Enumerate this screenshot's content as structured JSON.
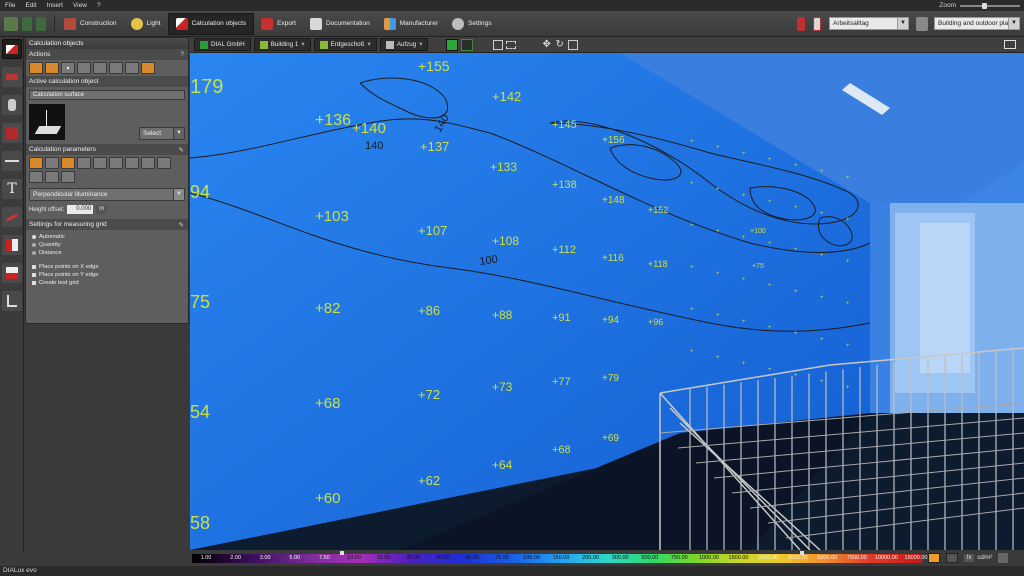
{
  "menu": [
    "File",
    "Edit",
    "Insert",
    "View",
    "?"
  ],
  "zoom_label": "Zoom",
  "toolbar": {
    "tabs": [
      {
        "label": "Construction",
        "icon": "construction-icon",
        "active": false
      },
      {
        "label": "Light",
        "icon": "light-icon",
        "active": false
      },
      {
        "label": "Calculation objects",
        "icon": "calculation-objects-icon",
        "active": true
      },
      {
        "label": "Export",
        "icon": "export-icon",
        "active": false
      },
      {
        "label": "Documentation",
        "icon": "documentation-icon",
        "active": false
      },
      {
        "label": "Manufacturer",
        "icon": "manufacturer-icon",
        "active": false
      },
      {
        "label": "Settings",
        "icon": "settings-icon",
        "active": false
      }
    ],
    "scene_select": "Arbeitsalltag",
    "view_select": "Building and outdoor pla..."
  },
  "panel": {
    "title": "Calculation objects",
    "actions_title": "Actions",
    "help": "?",
    "active_title": "Active calculation object",
    "surface_field": "Calculation surface",
    "select_button": "Select",
    "params_title": "Calculation parameters",
    "param_select": "Perpendicular illuminance",
    "height_label": "Height offset:",
    "height_value": "0.000",
    "height_unit": "m",
    "grid_title": "Settings for measuring grid",
    "grid_modes": [
      "Automatic",
      "Quantity",
      "Distance"
    ],
    "grid_options": [
      "Place points on X edge",
      "Place points on Y edge",
      "Create test grid"
    ]
  },
  "viewbar": {
    "tags": [
      "DIAL GmbH",
      "Building 1",
      "Erdgeschoß",
      "Aufzug"
    ]
  },
  "scene": {
    "wall_color": "#1f6fe0",
    "iso_color": "#1c1c1c",
    "value_color": "#c9e04a",
    "left_values": [
      "179",
      "94",
      "75",
      "54",
      "58"
    ],
    "contour_labels": [
      "100",
      "140",
      "140"
    ],
    "points": [
      {
        "v": "155"
      },
      {
        "v": "142"
      },
      {
        "v": "136"
      },
      {
        "v": "140"
      },
      {
        "v": "137"
      },
      {
        "v": "133"
      },
      {
        "v": "103"
      },
      {
        "v": "107"
      },
      {
        "v": "108"
      },
      {
        "v": "112"
      },
      {
        "v": "116"
      },
      {
        "v": "118"
      },
      {
        "v": "82"
      },
      {
        "v": "86"
      },
      {
        "v": "88"
      },
      {
        "v": "91"
      },
      {
        "v": "94"
      },
      {
        "v": "96"
      },
      {
        "v": "68"
      },
      {
        "v": "72"
      },
      {
        "v": "73"
      },
      {
        "v": "77"
      },
      {
        "v": "79"
      },
      {
        "v": "60"
      },
      {
        "v": "62"
      },
      {
        "v": "64"
      },
      {
        "v": "68"
      },
      {
        "v": "69"
      },
      {
        "v": "156"
      },
      {
        "v": "145"
      },
      {
        "v": "148"
      },
      {
        "v": "152"
      },
      {
        "v": "138"
      },
      {
        "v": "75"
      },
      {
        "v": "100"
      }
    ]
  },
  "legend": {
    "ticks": [
      "1.00",
      "2.00",
      "3.00",
      "5.00",
      "7.50",
      "10.00",
      "15.00",
      "20.00",
      "30.00",
      "50.00",
      "75.00",
      "100.00",
      "150.00",
      "200.00",
      "300.00",
      "500.00",
      "750.00",
      "1000.00",
      "1500.00",
      "2000.00",
      "3000.00",
      "5000.00",
      "7500.00",
      "10000.00",
      "15000.00"
    ],
    "unit_lx": "lx",
    "unit_cd": "cd/m²"
  },
  "status": "DIALux evo"
}
